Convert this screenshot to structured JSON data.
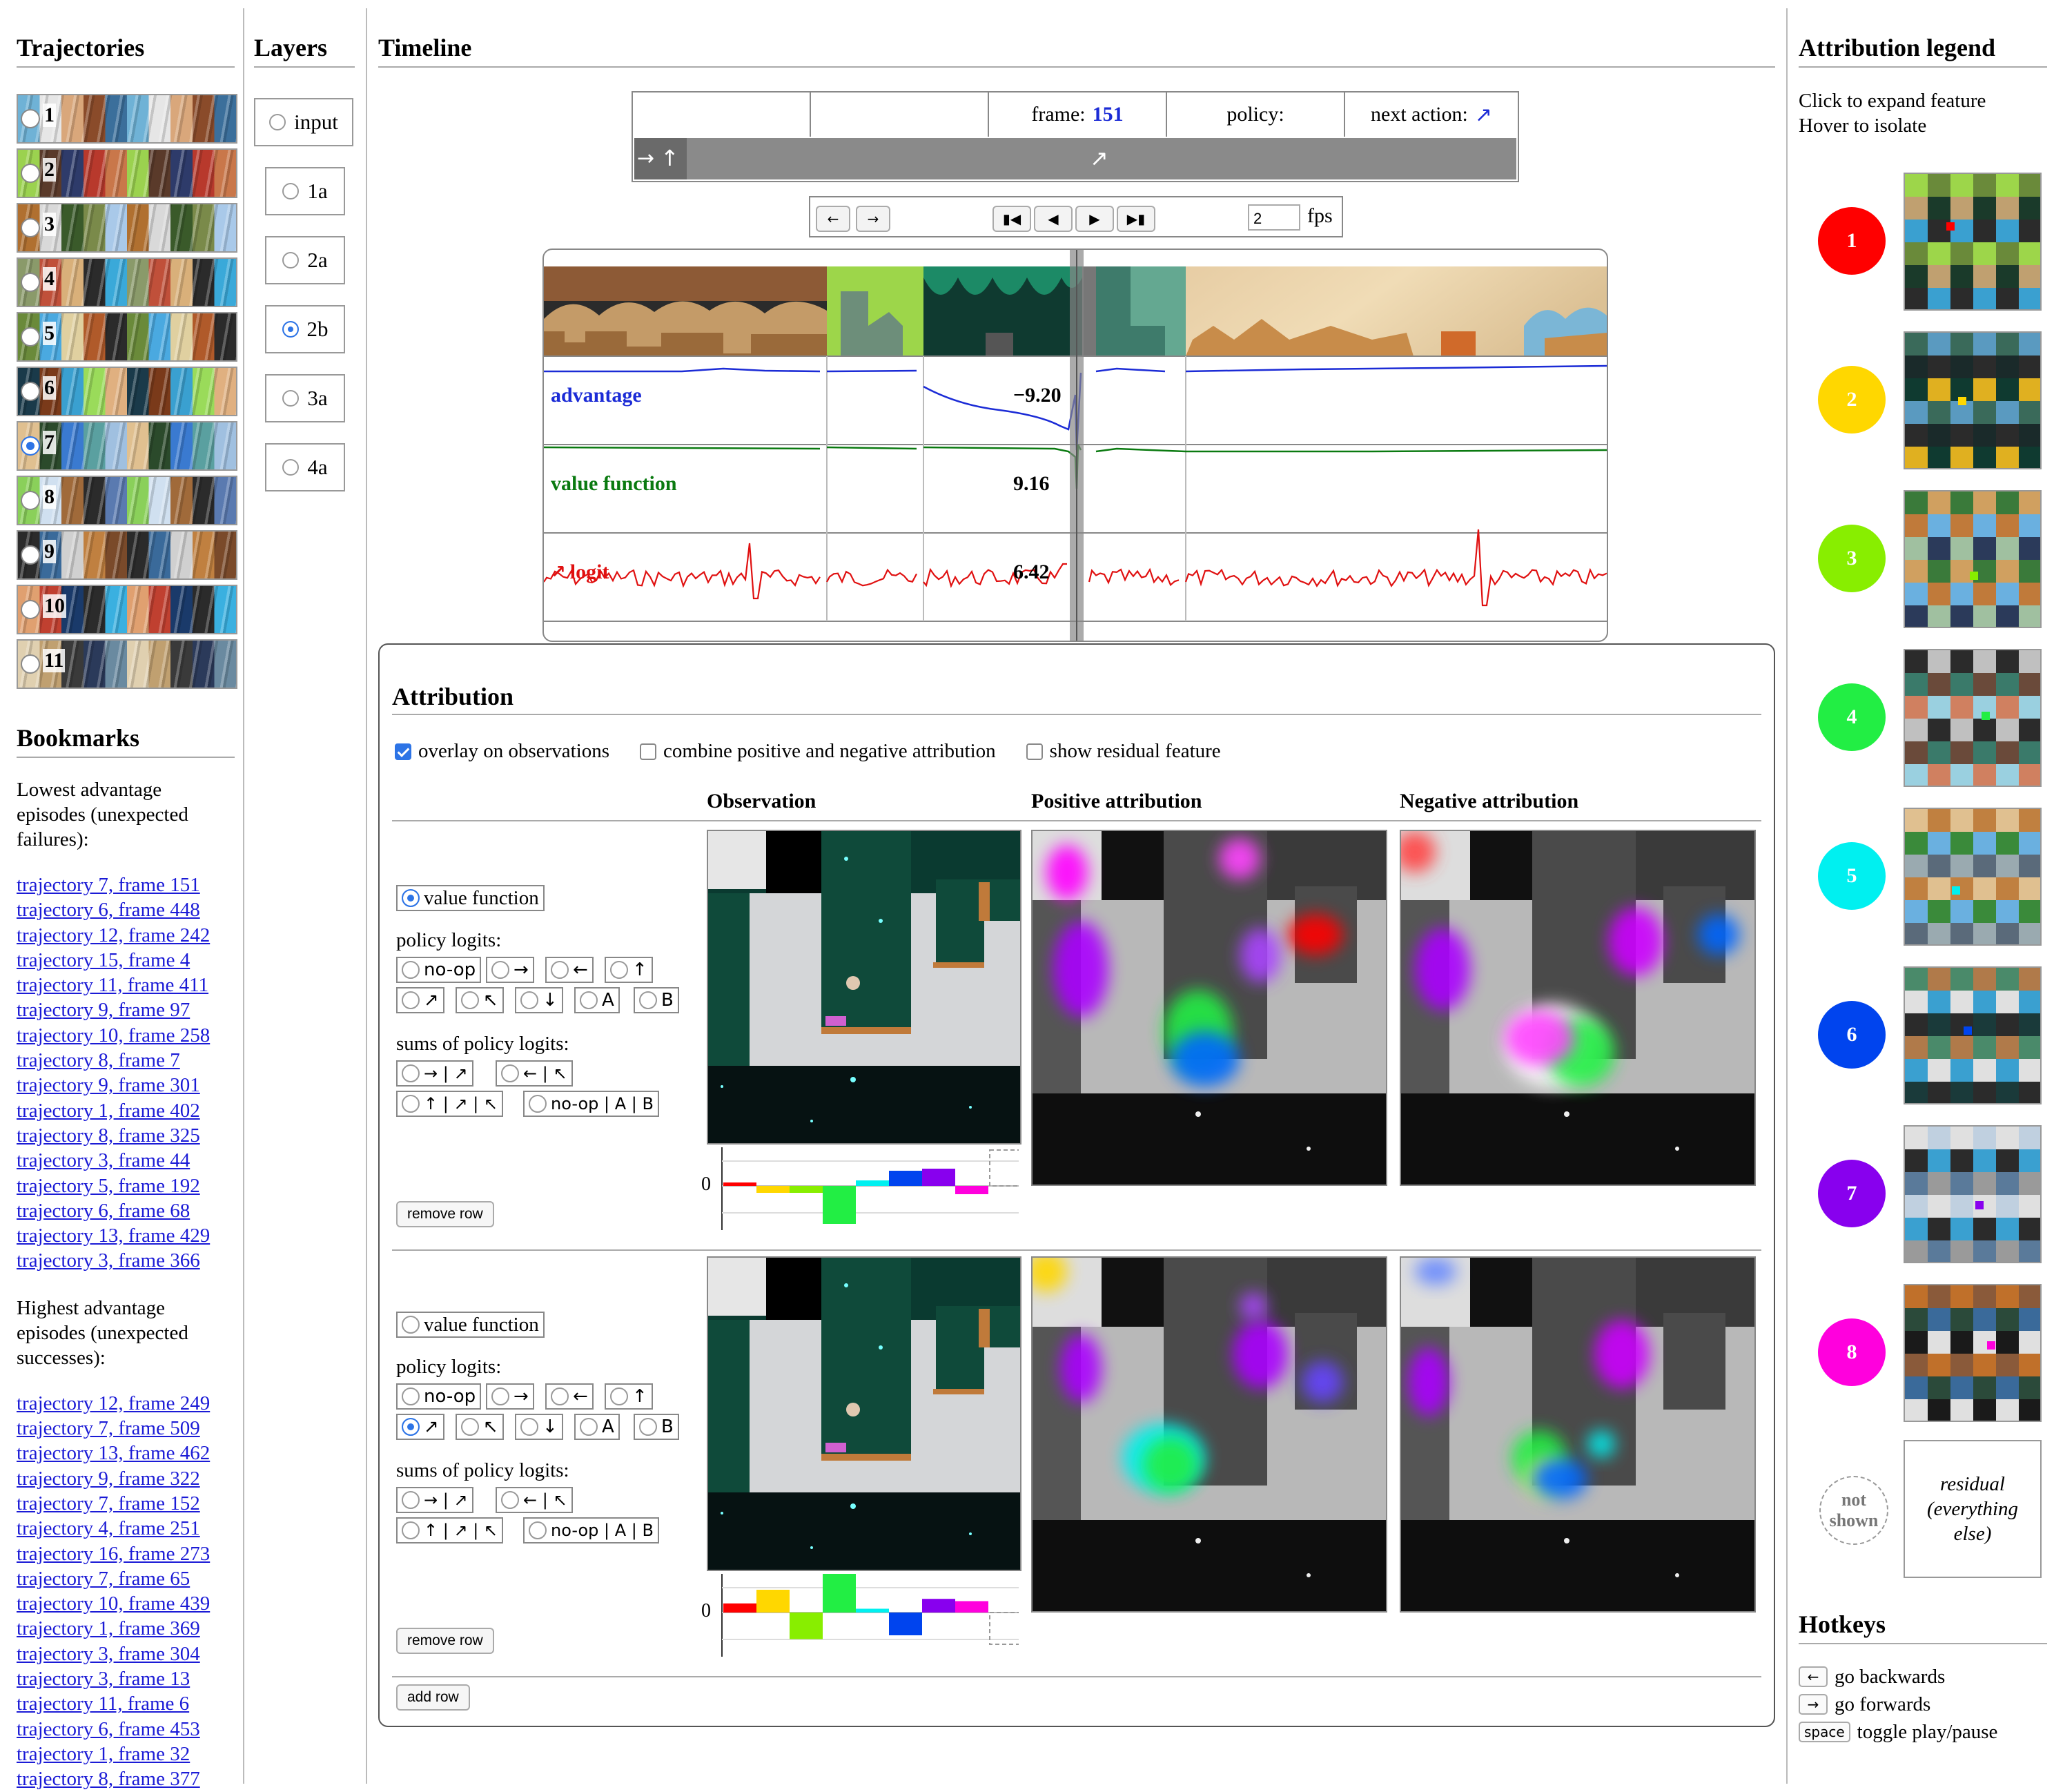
{
  "sidebar": {
    "title": "Trajectories",
    "trajectories": [
      "1",
      "2",
      "3",
      "4",
      "5",
      "6",
      "7",
      "8",
      "9",
      "10",
      "11"
    ],
    "selected_index": 6,
    "bookmarks_title": "Bookmarks",
    "lowest_heading": "Lowest advantage episodes (unexpected failures):",
    "lowest": [
      "trajectory 7, frame 151",
      "trajectory 6, frame 448",
      "trajectory 12, frame 242",
      "trajectory 15, frame 4",
      "trajectory 11, frame 411",
      "trajectory 9, frame 97",
      "trajectory 10, frame 258",
      "trajectory 8, frame 7",
      "trajectory 9, frame 301",
      "trajectory 1, frame 402",
      "trajectory 8, frame 325",
      "trajectory 3, frame 44",
      "trajectory 5, frame 192",
      "trajectory 6, frame 68",
      "trajectory 13, frame 429",
      "trajectory 3, frame 366"
    ],
    "highest_heading": "Highest advantage episodes (unexpected successes):",
    "highest": [
      "trajectory 12, frame 249",
      "trajectory 7, frame 509",
      "trajectory 13, frame 462",
      "trajectory 9, frame 322",
      "trajectory 7, frame 152",
      "trajectory 4, frame 251",
      "trajectory 16, frame 273",
      "trajectory 7, frame 65",
      "trajectory 10, frame 439",
      "trajectory 1, frame 369",
      "trajectory 3, frame 304",
      "trajectory 3, frame 13",
      "trajectory 11, frame 6",
      "trajectory 6, frame 453",
      "trajectory 1, frame 32",
      "trajectory 8, frame 377"
    ]
  },
  "layers": {
    "title": "Layers",
    "items": [
      "input",
      "1a",
      "2a",
      "2b",
      "3a",
      "4a"
    ],
    "selected": "2b"
  },
  "timeline": {
    "title": "Timeline",
    "frame_label": "frame:",
    "frame_value": "151",
    "policy_label": "policy:",
    "next_action_label": "next action:",
    "next_action_glyph": "↗",
    "fps_value": "2",
    "fps_label": "fps",
    "rows": [
      {
        "label": "advantage",
        "value": "−9.20",
        "color": "#1b2bd6"
      },
      {
        "label": "value function",
        "value": "9.16",
        "color": "#0a7a10"
      },
      {
        "label": "logit",
        "value": "6.42",
        "color": "#e01010",
        "glyph": "↗"
      }
    ]
  },
  "attribution": {
    "title": "Attribution",
    "options": [
      {
        "label": "overlay on observations",
        "checked": true
      },
      {
        "label": "combine positive and negative attribution",
        "checked": false
      },
      {
        "label": "show residual feature",
        "checked": false
      }
    ],
    "col_headers": [
      "Observation",
      "Positive attribution",
      "Negative attribution"
    ],
    "value_function_label": "value function",
    "policy_logits_label": "policy logits:",
    "logit_options": [
      "no-op",
      "→",
      "←",
      "↑",
      "↗",
      "↖",
      "↓",
      "A",
      "B"
    ],
    "sums_label": "sums of policy logits:",
    "sum_options": [
      "→ | ↗",
      "← | ↖",
      "↑ | ↗ | ↖",
      "no-op | A | B"
    ],
    "zero_label": "0",
    "remove_row_label": "remove row",
    "add_row_label": "add row",
    "rows": [
      {
        "selected": "value function",
        "bars": [
          0.05,
          -0.1,
          -0.1,
          -0.55,
          0.08,
          0.22,
          0.25,
          -0.12,
          0
        ]
      },
      {
        "selected": "↗",
        "bars": [
          0.12,
          0.3,
          -0.35,
          1.0,
          0.05,
          -0.3,
          0.18,
          0.15,
          -0.4
        ]
      }
    ]
  },
  "legend": {
    "title": "Attribution legend",
    "hint1": "Click to expand feature",
    "hint2": "Hover to isolate",
    "features": [
      {
        "n": "1",
        "color": "#ff0000"
      },
      {
        "n": "2",
        "color": "#ffd700"
      },
      {
        "n": "3",
        "color": "#88ee00"
      },
      {
        "n": "4",
        "color": "#22ee44"
      },
      {
        "n": "5",
        "color": "#00f0f0"
      },
      {
        "n": "6",
        "color": "#0044ee"
      },
      {
        "n": "7",
        "color": "#8800ee"
      },
      {
        "n": "8",
        "color": "#ff00dd"
      }
    ],
    "not_shown_label": "not shown",
    "residual_label": "residual (everything else)",
    "hotkeys_title": "Hotkeys",
    "hotkeys": [
      {
        "key": "←",
        "label": "go backwards"
      },
      {
        "key": "→",
        "label": "go forwards"
      },
      {
        "key": "space",
        "label": "toggle play/pause"
      }
    ]
  }
}
